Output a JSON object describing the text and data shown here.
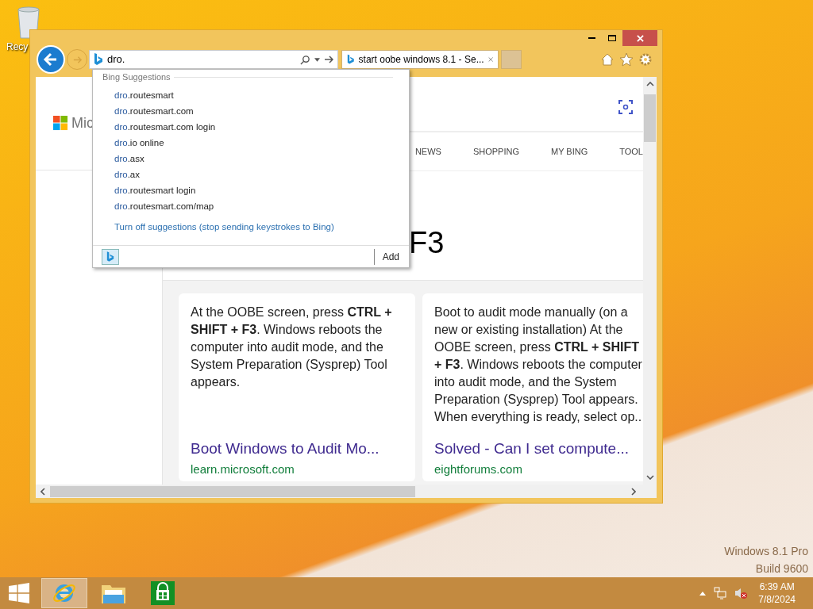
{
  "desktop": {
    "icons": [
      {
        "label": "Recy"
      }
    ],
    "watermark": [
      "Windows 8.1 Pro",
      "Build 9600"
    ]
  },
  "browser": {
    "address": {
      "value": "dro."
    },
    "tabs": [
      {
        "title": "start oobe windows 8.1 - Se...",
        "selected": true
      }
    ],
    "suggestions": {
      "heading": "Bing Suggestions",
      "items": [
        {
          "match": "dro",
          "rest": ".routesmart"
        },
        {
          "match": "dro",
          "rest": ".routesmart.com"
        },
        {
          "match": "dro",
          "rest": ".routesmart.com login"
        },
        {
          "match": "dro",
          "rest": ".io online"
        },
        {
          "match": "dro",
          "rest": ".asx"
        },
        {
          "match": "dro",
          "rest": ".ax"
        },
        {
          "match": "dro",
          "rest": ".routesmart login"
        },
        {
          "match": "dro",
          "rest": ".routesmart.com/map"
        }
      ],
      "turn_off": "Turn off suggestions (stop sending keystrokes to Bing)",
      "add": "Add"
    },
    "page": {
      "logo_text": "Mic",
      "nav": [
        "NEWS",
        "SHOPPING",
        "MY BING",
        "TOOL"
      ],
      "heading": "F3",
      "cards": [
        {
          "text": "At the OOBE screen, press **CTRL + SHIFT + F3**. Windows reboots the computer into audit mode, and the System Preparation (Sysprep) Tool appears.",
          "title": "Boot Windows to Audit Mo...",
          "source": "learn.microsoft.com"
        },
        {
          "text": "Boot to audit mode manually (on a new or existing installation) At the OOBE screen, press **CTRL + SHIFT + F3**. Windows reboots the computer into audit mode, and the System Preparation (Sysprep) Tool appears. When everything is ready, select op..",
          "title": "Solved - Can I set compute...",
          "source": "eightforums.com"
        }
      ]
    }
  },
  "taskbar": {
    "apps": [
      {
        "kind": "explorer",
        "selected": true
      },
      {
        "kind": "files",
        "selected": false
      },
      {
        "kind": "store",
        "selected": false
      }
    ],
    "time": "6:39 AM",
    "date": "7/8/2024"
  }
}
